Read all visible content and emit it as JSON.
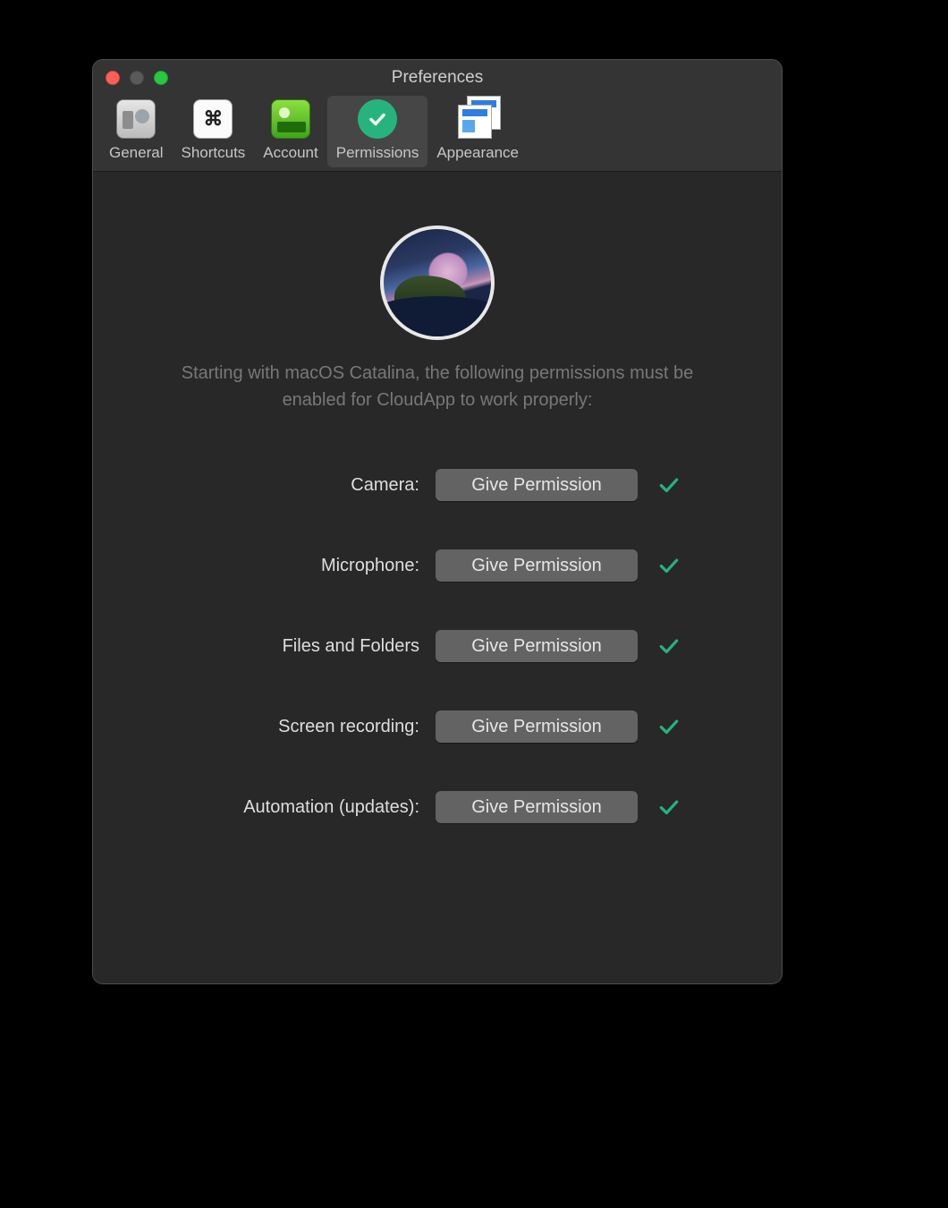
{
  "window": {
    "title": "Preferences"
  },
  "toolbar": {
    "items": [
      {
        "id": "general",
        "label": "General"
      },
      {
        "id": "shortcuts",
        "label": "Shortcuts"
      },
      {
        "id": "account",
        "label": "Account"
      },
      {
        "id": "permissions",
        "label": "Permissions"
      },
      {
        "id": "appearance",
        "label": "Appearance"
      }
    ],
    "selected": "permissions"
  },
  "intro": "Starting with macOS Catalina, the following permissions must be enabled for CloudApp to work properly:",
  "permissions": {
    "button_label": "Give Permission",
    "items": [
      {
        "id": "camera",
        "label": "Camera:",
        "granted": true
      },
      {
        "id": "microphone",
        "label": "Microphone:",
        "granted": true
      },
      {
        "id": "files-folders",
        "label": "Files and Folders",
        "granted": true
      },
      {
        "id": "screen-recording",
        "label": "Screen recording:",
        "granted": true
      },
      {
        "id": "automation",
        "label": "Automation (updates):",
        "granted": true
      }
    ]
  },
  "colors": {
    "accent": "#25b27e"
  }
}
